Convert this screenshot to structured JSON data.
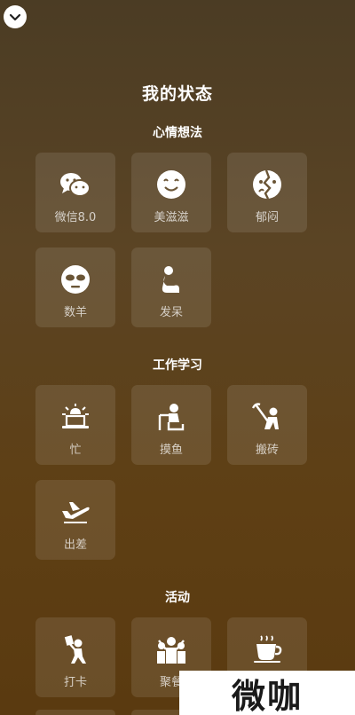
{
  "header": {
    "title": "我的状态"
  },
  "sections": [
    {
      "title": "心情想法",
      "items": [
        {
          "label": "微信8.0",
          "icon": "chat-bubbles-icon"
        },
        {
          "label": "美滋滋",
          "icon": "smile-icon"
        },
        {
          "label": "郁闷",
          "icon": "cracked-face-icon"
        },
        {
          "label": "数羊",
          "icon": "sleepy-face-icon"
        },
        {
          "label": "发呆",
          "icon": "sitting-person-icon"
        }
      ]
    },
    {
      "title": "工作学习",
      "items": [
        {
          "label": "忙",
          "icon": "alarm-laptop-icon"
        },
        {
          "label": "摸鱼",
          "icon": "desk-person-icon"
        },
        {
          "label": "搬砖",
          "icon": "pickaxe-worker-icon"
        },
        {
          "label": "出差",
          "icon": "airplane-icon"
        }
      ]
    },
    {
      "title": "活动",
      "items": [
        {
          "label": "打卡",
          "icon": "check-in-person-icon"
        },
        {
          "label": "聚餐",
          "icon": "group-people-icon"
        },
        {
          "label": "",
          "icon": "coffee-cup-icon"
        }
      ]
    }
  ],
  "watermark": {
    "text": "微咖"
  },
  "colors": {
    "tile_bg": "rgba(255,255,255,0.10)",
    "label": "#cfc3ad"
  }
}
